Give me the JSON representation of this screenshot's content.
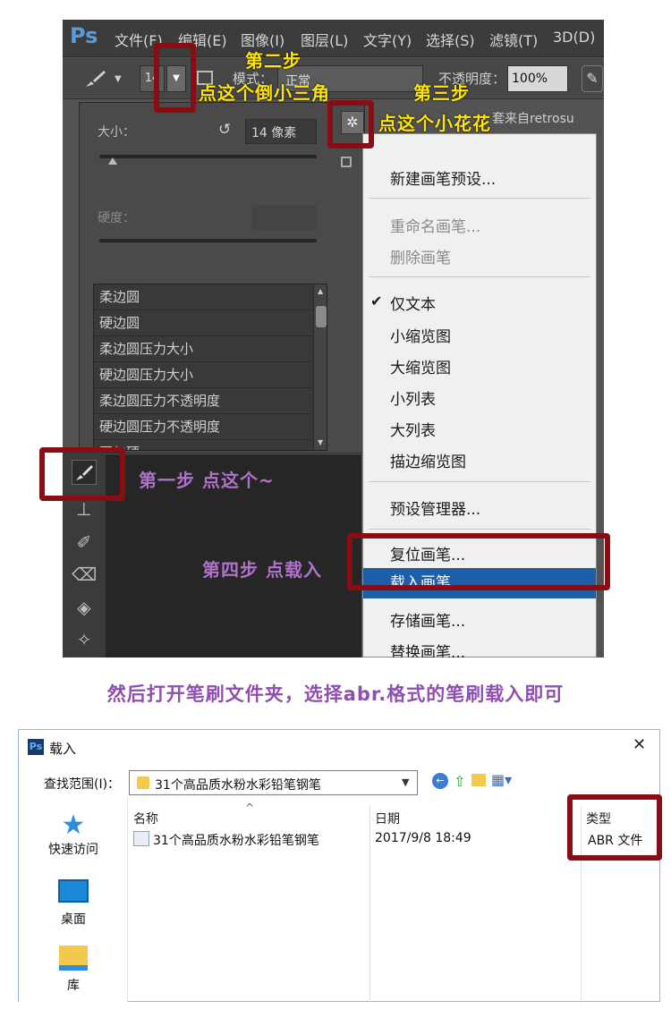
{
  "ps": {
    "logo": "Ps",
    "menus": [
      "文件(F)",
      "编辑(E)",
      "图像(I)",
      "图层(L)",
      "文字(Y)",
      "选择(S)",
      "滤镜(T)",
      "3D(D)"
    ],
    "options": {
      "brush_size_value": "14",
      "mode_label": "模式：",
      "mode_value": "正常",
      "opacity_label": "不透明度：",
      "opacity_value": "100%",
      "doc_tab_text": "套来自retrosu"
    },
    "brush_popup": {
      "size_label": "大小：",
      "size_value": "14 像素",
      "hardness_label": "硬度：",
      "presets": [
        "柔边圆",
        "硬边圆",
        "柔边圆压力大小",
        "硬边圆压力大小",
        "柔边圆压力不透明度",
        "硬边圆压力不透明度",
        "回与硬"
      ]
    },
    "panel_menu": {
      "group1": [
        "新建画笔预设..."
      ],
      "group2": [
        "重命名画笔...",
        "删除画笔"
      ],
      "group3": [
        "仅文本",
        "小缩览图",
        "大缩览图",
        "小列表",
        "大列表",
        "描边缩览图"
      ],
      "checked_item": "✔",
      "group4": [
        "预设管理器..."
      ],
      "group5": [
        "复位画笔...",
        "载入画笔...",
        "存储画笔...",
        "替换画笔..."
      ]
    }
  },
  "annotations": {
    "step1": "第一步  点这个~",
    "step2_line1": "第二步",
    "step2_line2": "点这个倒小三角",
    "step3_line1": "第三步",
    "step3_line2": "点这个小花花",
    "step4": "第四步  点载入"
  },
  "caption": "然后打开笔刷文件夹，选择abr.格式的笔刷载入即可",
  "dialog": {
    "app_icon": "Ps",
    "title": "载入",
    "close_label": "✕",
    "lookin_label": "查找范围(I)：",
    "folder_name": "31个高品质水粉水彩铅笔钢笔",
    "side_items": [
      "快速访问",
      "桌面",
      "库"
    ],
    "columns": {
      "name": "名称",
      "date": "日期",
      "type": "类型"
    },
    "files": [
      {
        "name": "31个高品质水粉水彩铅笔钢笔",
        "date": "2017/9/8 18:49",
        "type": "ABR 文件"
      }
    ]
  },
  "colors": {
    "annotation_box": "#880e14",
    "annotation_yellow": "#ffe600",
    "annotation_purple": "#b071cc",
    "highlight": "#1c5fa8"
  }
}
